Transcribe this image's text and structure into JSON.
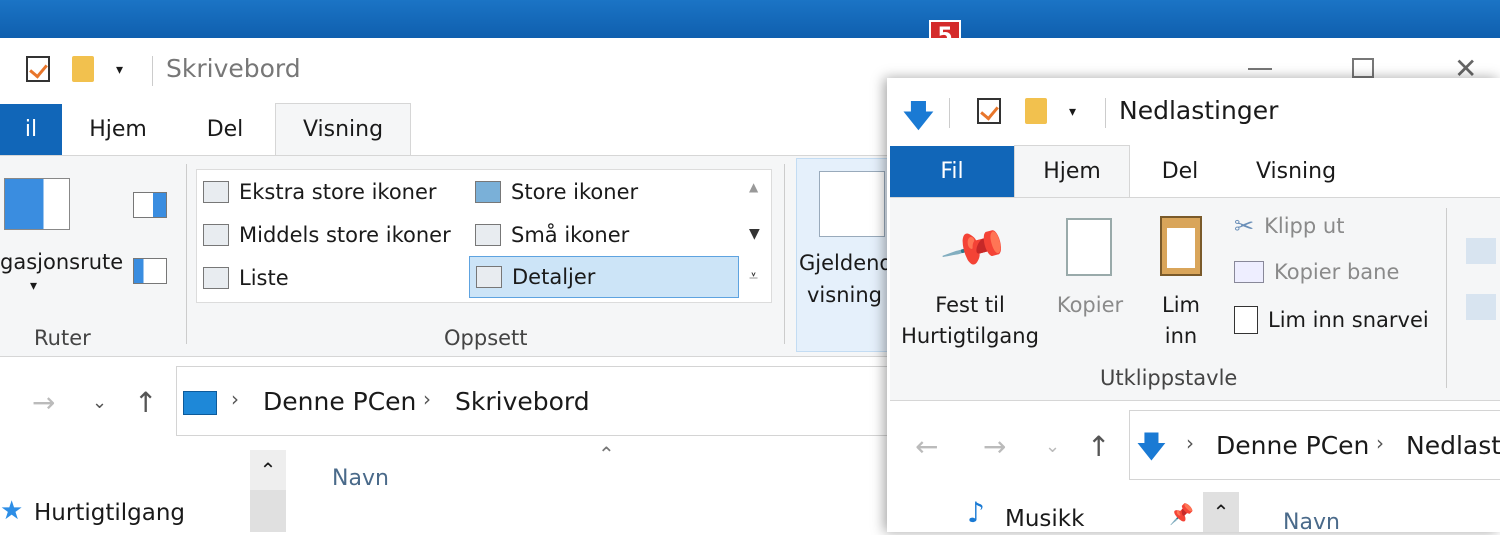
{
  "badge": "5",
  "back_window": {
    "title": "Skrivebord",
    "tabs": {
      "fil": "il",
      "hjem": "Hjem",
      "del": "Del",
      "visning": "Visning"
    },
    "ruter": {
      "pane_label": "gasjonsrute",
      "group_label": "Ruter"
    },
    "layout": {
      "items": [
        "Ekstra store ikoner",
        "Store ikoner",
        "Middels store ikoner",
        "Små ikoner",
        "Liste",
        "Detaljer"
      ],
      "selected": "Detaljer",
      "group_label": "Oppsett"
    },
    "current_view": {
      "line1": "Gjeldend",
      "line2": "visning"
    },
    "breadcrumb": [
      "Denne PCen",
      "Skrivebord"
    ],
    "column_header": "Navn",
    "nav_item": "Hurtigtilgang"
  },
  "front_window": {
    "title": "Nedlastinger",
    "tabs": {
      "fil": "Fil",
      "hjem": "Hjem",
      "del": "Del",
      "visning": "Visning"
    },
    "clipboard": {
      "pin_line1": "Fest til",
      "pin_line2": "Hurtigtilgang",
      "copy": "Kopier",
      "paste_line1": "Lim",
      "paste_line2": "inn",
      "cut": "Klipp ut",
      "copy_path": "Kopier bane",
      "paste_shortcut": "Lim inn snarvei",
      "group_label": "Utklippstavle"
    },
    "breadcrumb": [
      "Denne PCen",
      "Nedlast"
    ],
    "nav_item": "Musikk",
    "column_header": "Navn"
  },
  "colors": {
    "titlebar": "#1166b8",
    "accent": "#0f5fae",
    "selection": "#cce4f7",
    "badge": "#d42b2b"
  }
}
